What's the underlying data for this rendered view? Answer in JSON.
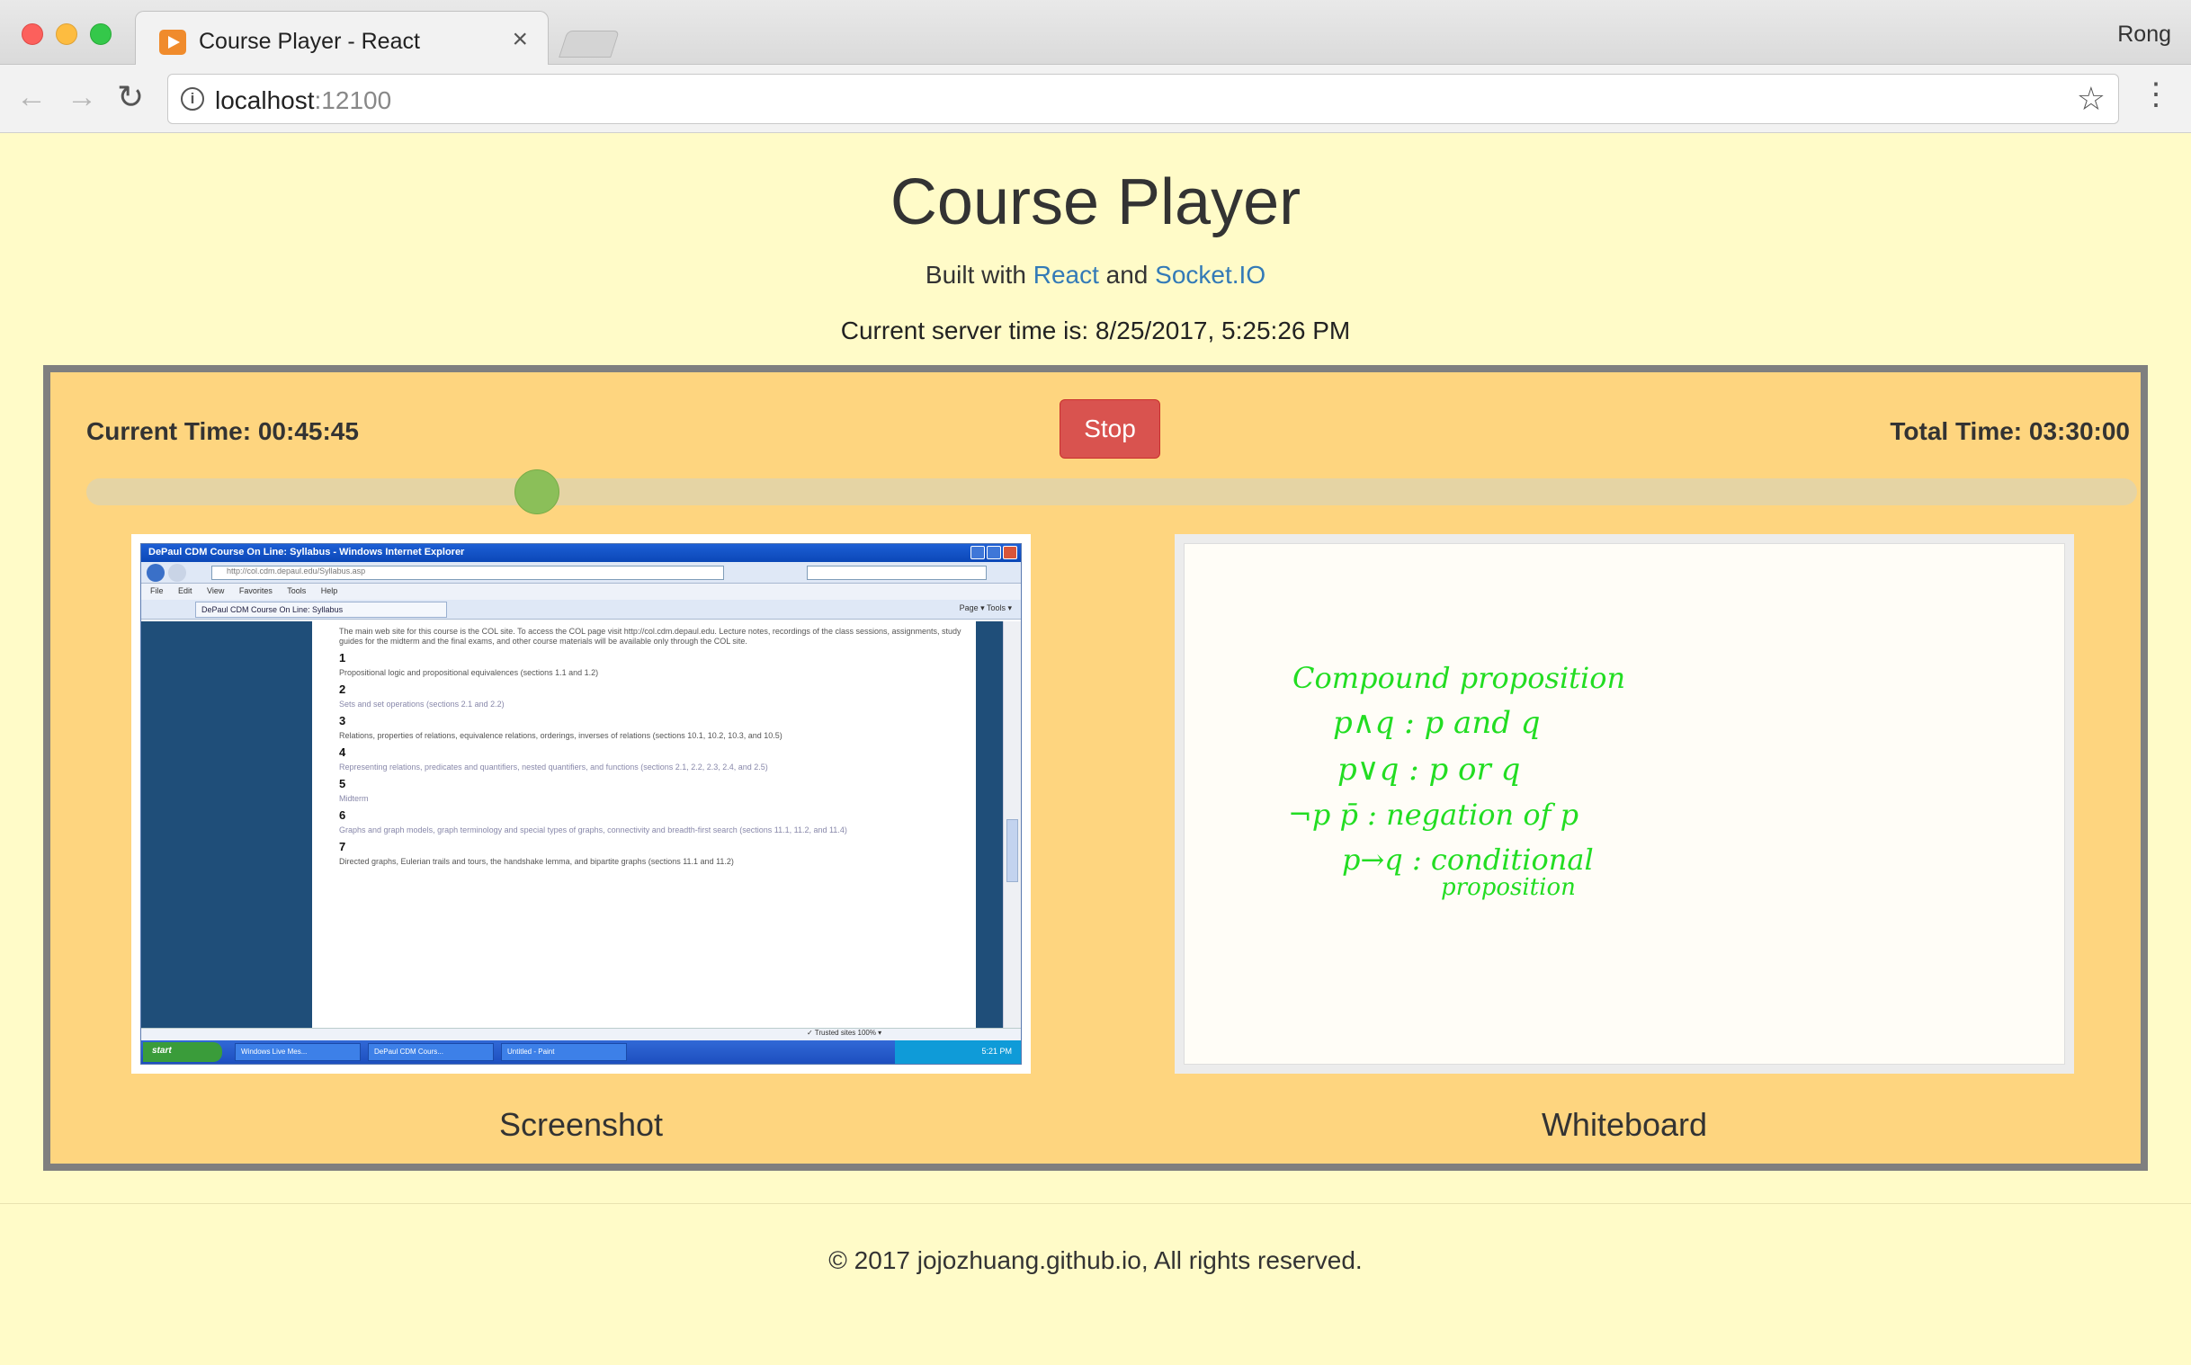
{
  "browser": {
    "tab_title": "Course Player - React",
    "tab_close": "×",
    "profile": "Rong",
    "url_host": "localhost",
    "url_port": ":12100",
    "back_glyph": "←",
    "forward_glyph": "→",
    "reload_glyph": "↻",
    "star_glyph": "☆",
    "menu_glyph": "⋮",
    "info_glyph": "i"
  },
  "page": {
    "title": "Course Player",
    "built_with": "Built with",
    "react_link": "React",
    "and": "and",
    "socket_link": "Socket.IO",
    "server_time": "Current server time is: 8/25/2017, 5:25:26 PM"
  },
  "player": {
    "current_time": "Current Time: 00:45:45",
    "total_time": "Total Time: 03:30:00",
    "stop_label": "Stop",
    "progress": 0.2179,
    "colors": {
      "panel_bg": "#fed57f",
      "border": "#7f7f7f",
      "stop_button": "#d9534f",
      "thumb": "#8bbf59",
      "track": "#e5d4a4",
      "ink": "#22dd22"
    }
  },
  "screenshot": {
    "label": "Screenshot",
    "ie_title": "DePaul CDM Course On Line: Syllabus - Windows Internet Explorer",
    "ie_url": "http://col.cdm.depaul.edu/Syllabus.asp",
    "ie_menu": "File Edit View Favorites Tools Help",
    "ie_tab": "DePaul CDM Course On Line: Syllabus",
    "ie_tools": "Page ▾ Tools ▾",
    "intro": "The main web site for this course is the COL site. To access the COL page visit http://col.cdm.depaul.edu. Lecture notes, recordings of the class sessions, assignments, study guides for the midterm and the final exams, and other course materials will be available only through the COL site.",
    "sections": [
      {
        "num": "1",
        "text": "Propositional logic and propositional equivalences (sections 1.1 and 1.2)"
      },
      {
        "num": "2",
        "text": "Sets and set operations (sections 2.1 and 2.2)"
      },
      {
        "num": "3",
        "text": "Relations, properties of relations, equivalence relations, orderings, inverses of relations (sections 10.1, 10.2, 10.3, and 10.5)"
      },
      {
        "num": "4",
        "text": "Representing relations, predicates and quantifiers, nested quantifiers, and functions (sections 2.1, 2.2, 2.3, 2.4, and 2.5)"
      },
      {
        "num": "5",
        "text": "Midterm"
      },
      {
        "num": "6",
        "text": "Graphs and graph models, graph terminology and special types of graphs, connectivity and breadth-first search (sections 11.1, 11.2, and 11.4)"
      },
      {
        "num": "7",
        "text": "Directed graphs, Eulerian trails and tours, the handshake lemma, and bipartite graphs (sections 11.1 and 11.2)"
      }
    ],
    "status": "✓ Trusted sites   100% ▾",
    "start": "start",
    "taskbar_items": [
      "Windows Live Mes...",
      "DePaul CDM Cours...",
      "Untitled - Paint"
    ],
    "clock": "5:21 PM"
  },
  "whiteboard": {
    "label": "Whiteboard",
    "notes": [
      {
        "text": "Compound proposition"
      },
      {
        "text": "p∧q : p and q"
      },
      {
        "text": "p∨q : p or q"
      },
      {
        "text": "¬p  p̄ : negation of p"
      },
      {
        "text": "p→q : conditional"
      },
      {
        "text": "proposition"
      }
    ]
  },
  "footer": {
    "copyright": "© 2017 jojozhuang.github.io, All rights reserved."
  }
}
